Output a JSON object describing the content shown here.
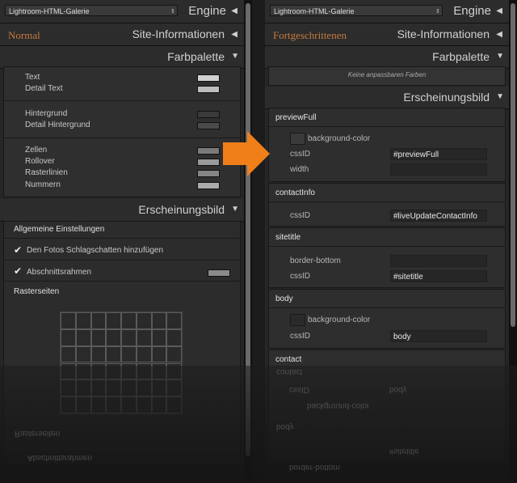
{
  "left": {
    "engine_select": "Lightroom-HTML-Galerie",
    "engine_label": "Engine",
    "preset_label": "Normal",
    "site_info": "Site-Informationen",
    "farbpalette": "Farbpalette",
    "palette_groups": [
      [
        "Text",
        "Detail Text"
      ],
      [
        "Hintergrund",
        "Detail Hintergrund"
      ],
      [
        "Zellen",
        "Rollover",
        "Rasterlinien",
        "Nummern"
      ]
    ],
    "erscheinungsbild": "Erscheinungsbild",
    "allgemeine": "Allgemeine Einstellungen",
    "schatten": "Den Fotos Schlagschatten hinzufügen",
    "abschnitt": "Abschnittsrahmen",
    "rasterseiten": "Rasterseiten",
    "mirror_rasterseiten": "Rasterseiten",
    "mirror_abschnitt": "Abschnittsrahmen"
  },
  "right": {
    "engine_select": "Lightroom-HTML-Galerie",
    "engine_label": "Engine",
    "preset_label": "Fortgeschrittenen",
    "site_info": "Site-Informationen",
    "farbpalette": "Farbpalette",
    "keine_farben": "Keine anpassbaren Farben",
    "erscheinungsbild": "Erscheinungsbild",
    "blocks": {
      "previewFull": {
        "title": "previewFull",
        "bgcolor": "background-color",
        "cssid_label": "cssID",
        "cssid": "#previewFull",
        "width": "width"
      },
      "contactInfo": {
        "title": "contactInfo",
        "cssid_label": "cssID",
        "cssid": "#liveUpdateContactInfo"
      },
      "sitetitle": {
        "title": "sitetitle",
        "border": "border-bottom",
        "cssid_label": "cssID",
        "cssid": "#sitetitle"
      },
      "body": {
        "title": "body",
        "bgcolor": "background-color",
        "cssid_label": "cssID",
        "cssid": "body"
      },
      "contact": {
        "title": "contact"
      }
    },
    "mirror_contact": "contact",
    "mirror_cssid": "cssID",
    "mirror_body": "body",
    "mirror_bgcolor": "background-color",
    "mirror_body_title": "body",
    "mirror_sitetitle": "#sitetitle",
    "mirror_border": "border-bottom"
  },
  "colors": {
    "accent_arrow": "#f07f1a",
    "preset_text": "#c57a3c"
  }
}
